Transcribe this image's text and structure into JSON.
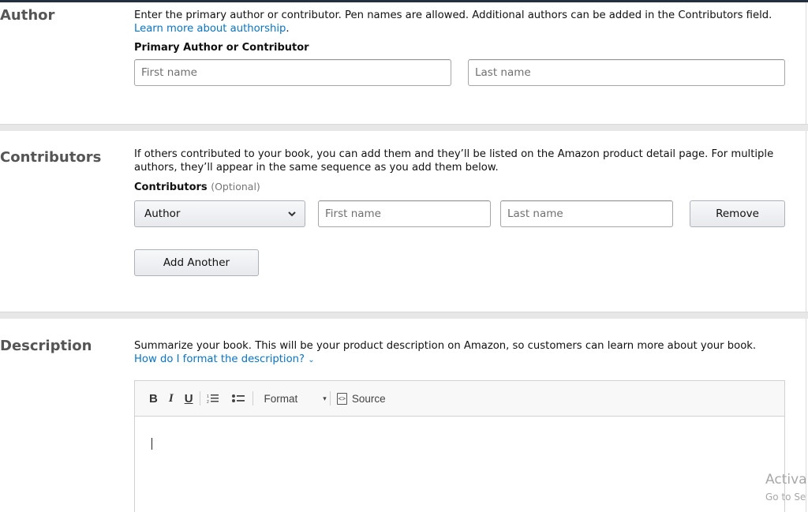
{
  "author": {
    "title": "Author",
    "help_text": "Enter the primary author or contributor. Pen names are allowed. Additional authors can be added in the Contributors field. ",
    "help_link": "Learn more about authorship",
    "help_end": ".",
    "field_label": "Primary Author or Contributor",
    "first_name_placeholder": "First name",
    "last_name_placeholder": "Last name"
  },
  "contributors": {
    "title": "Contributors",
    "help_text": "If others contributed to your book, you can add them and they’ll be listed on the Amazon product detail page. For multiple authors, they’ll appear in the same sequence as you add them below.",
    "field_label": "Contributors",
    "optional_label": "(Optional)",
    "role_selected": "Author",
    "first_name_placeholder": "First name",
    "last_name_placeholder": "Last name",
    "remove_label": "Remove",
    "add_another_label": "Add Another"
  },
  "description": {
    "title": "Description",
    "help_text": "Summarize your book. This will be your product description on Amazon, so customers can learn more about your book. ",
    "help_link": "How do I format the description?",
    "help_link_chevron": "⌄",
    "toolbar": {
      "bold": "B",
      "italic": "I",
      "underline": "U",
      "format_label": "Format",
      "format_caret": "▾",
      "source_label": "Source"
    },
    "editor_value": ""
  },
  "watermark": {
    "line1": "Activa",
    "line2": "Go to Se"
  }
}
